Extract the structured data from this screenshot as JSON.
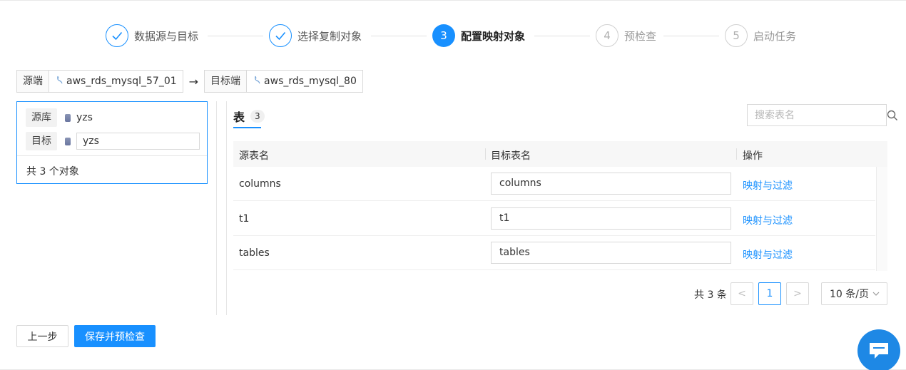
{
  "steps": [
    {
      "index": "1",
      "title": "数据源与目标",
      "status": "done"
    },
    {
      "index": "2",
      "title": "选择复制对象",
      "status": "done"
    },
    {
      "index": "3",
      "title": "配置映射对象",
      "status": "active"
    },
    {
      "index": "4",
      "title": "预检查",
      "status": "wait"
    },
    {
      "index": "5",
      "title": "启动任务",
      "status": "wait"
    }
  ],
  "header": {
    "source_label": "源端",
    "source_value": "aws_rds_mysql_57_01",
    "arrow": "→",
    "target_label": "目标端",
    "target_value": "aws_rds_mysql_80"
  },
  "left_panel": {
    "source_db_label": "源库",
    "source_db_value": "yzs",
    "target_db_label": "目标",
    "target_db_value": "yzs",
    "count_text": "共 3 个对象"
  },
  "tab": {
    "title": "表",
    "count": "3"
  },
  "search": {
    "placeholder": "搜索表名"
  },
  "table": {
    "headers": [
      "源表名",
      "目标表名",
      "操作"
    ],
    "rows": [
      {
        "source": "columns",
        "target": "columns",
        "action": "映射与过滤"
      },
      {
        "source": "t1",
        "target": "t1",
        "action": "映射与过滤"
      },
      {
        "source": "tables",
        "target": "tables",
        "action": "映射与过滤"
      }
    ]
  },
  "pagination": {
    "total_text": "共 3 条",
    "prev": "<",
    "current_page": "1",
    "next": ">",
    "page_size": "10 条/页"
  },
  "footer": {
    "prev_label": "上一步",
    "save_label": "保存并预检查"
  },
  "colors": {
    "accent": "#1890ff",
    "border": "#d9d9d9"
  },
  "icons": [
    "check-icon",
    "datasource-icon",
    "arrow-right-icon",
    "database-icon",
    "search-icon",
    "chevron-down-icon",
    "chat-icon"
  ]
}
